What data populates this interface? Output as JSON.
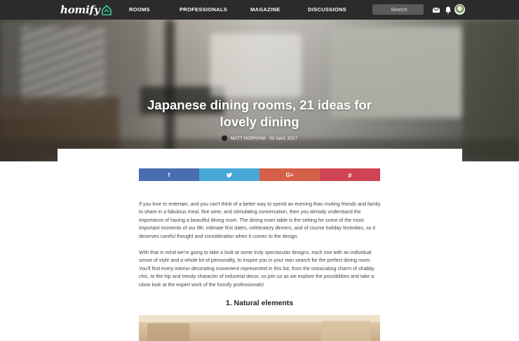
{
  "nav": {
    "logo": "homify",
    "links": [
      "ROOMS",
      "PROFESSIONALS",
      "MAGAZINE",
      "DISCUSSIONS"
    ],
    "search_placeholder": "Search",
    "icons": [
      "mail-icon",
      "bell-icon",
      "user-avatar"
    ]
  },
  "article": {
    "title": "Japanese dining rooms, 21 ideas for lovely dining",
    "author": "MATT HORNYAK",
    "date": "02 April, 2017",
    "share": {
      "facebook": "f",
      "twitter": "t",
      "googleplus": "G+",
      "pinterest": "p"
    },
    "paragraphs": [
      "If you love to entertain, and you can't think of a better way to spend an evening than inviting friends and family to share in a fabulous meal, fine wine, and stimulating conversation, then you already understand the importance of having a beautiful dining room. The dining room table is the setting for some of the most important moments of our life; intimate first dates, celebratory dinners, and of course holiday festivities, so it deserves careful thought and consideration when it comes to the design.",
      "With that in mind we're going to take a look at some truly spectacular designs, each one with an individual sense of style and a whole lot of personality, to inspire you in your own search for the perfect dining room. You'll find every interior decorating movement represented in this list, from the intoxicating charm of shabby chic, to the hip and trendy character of industrial decor, so join us as we explore the possibilities and take a close look at the expert work of the homify professionals!"
    ],
    "section_heading": "1. Natural elements"
  },
  "colors": {
    "nav_bg": "#2b2b2b",
    "facebook": "#4a6db2",
    "twitter": "#4aa8d8",
    "googleplus": "#d5604a",
    "pinterest": "#cf4455"
  }
}
